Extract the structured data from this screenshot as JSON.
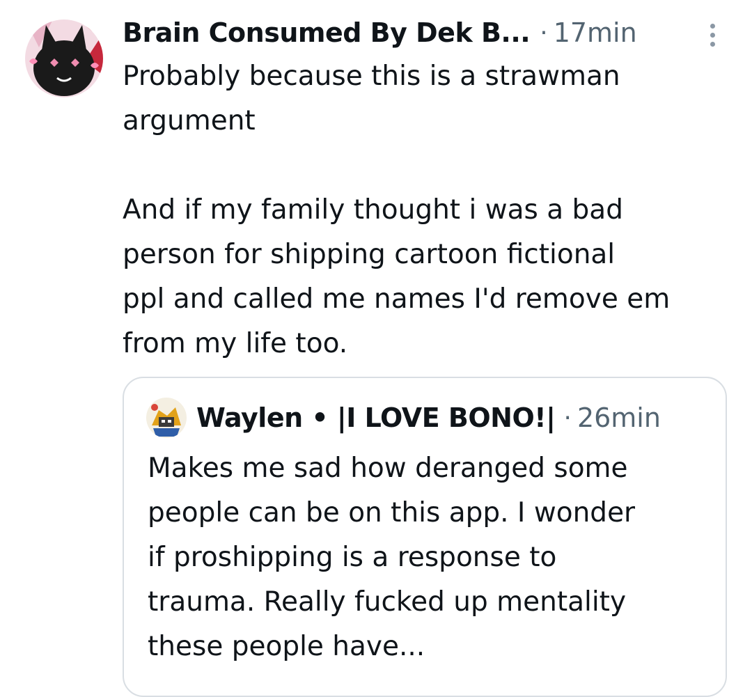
{
  "tweet": {
    "author_name": "Brain Consumed By Dek B...",
    "separator": "·",
    "timestamp": "17min",
    "body": "Probably because this is a strawman\nargument\n\nAnd if my family thought i was a bad\nperson for shipping cartoon fictional\nppl and called me names I'd remove em\nfrom my life too."
  },
  "quote": {
    "author_name": "Waylen • |I LOVE BONO!|",
    "separator": "·",
    "timestamp": "26min",
    "body": "Makes me sad how deranged some\npeople can be on this app. I wonder\nif proshipping is a response to\ntrauma. Really fucked up mentality\nthese people have..."
  },
  "icons": {
    "more": "more-vertical-icon",
    "avatar": "avatar-image",
    "quote_avatar": "avatar-image"
  },
  "colors": {
    "text_primary": "#0f1419",
    "text_secondary": "#536471",
    "border": "#d9dee3",
    "background": "#ffffff"
  }
}
